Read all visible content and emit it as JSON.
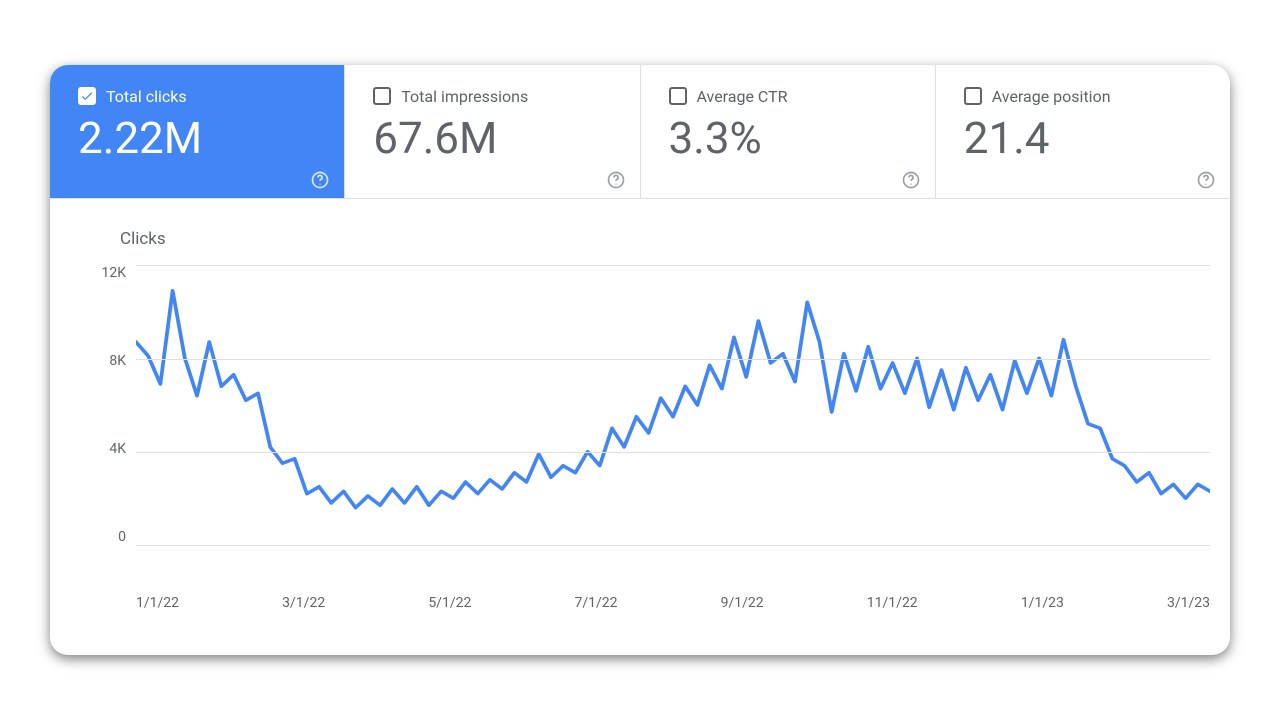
{
  "metrics": [
    {
      "key": "clicks",
      "label": "Total clicks",
      "value": "2.22M",
      "active": true
    },
    {
      "key": "impressions",
      "label": "Total impressions",
      "value": "67.6M",
      "active": false
    },
    {
      "key": "ctr",
      "label": "Average CTR",
      "value": "3.3%",
      "active": false
    },
    {
      "key": "position",
      "label": "Average position",
      "value": "21.4",
      "active": false
    }
  ],
  "chart_data": {
    "type": "line",
    "title": "Clicks",
    "ylabel": "",
    "xlabel": "",
    "ylim": [
      0,
      12000
    ],
    "y_ticks": [
      "12K",
      "8K",
      "4K",
      "0"
    ],
    "x_ticks": [
      "1/1/22",
      "3/1/22",
      "5/1/22",
      "7/1/22",
      "9/1/22",
      "11/1/22",
      "1/1/23",
      "3/1/23"
    ],
    "series": [
      {
        "name": "Clicks",
        "color": "#4285F4",
        "values": [
          8700,
          8100,
          6900,
          10900,
          8000,
          6400,
          8700,
          6800,
          7300,
          6200,
          6500,
          4200,
          3500,
          3700,
          2200,
          2500,
          1800,
          2300,
          1600,
          2100,
          1700,
          2400,
          1800,
          2500,
          1700,
          2300,
          2000,
          2700,
          2200,
          2800,
          2400,
          3100,
          2700,
          3900,
          2900,
          3400,
          3100,
          4000,
          3400,
          5000,
          4200,
          5500,
          4800,
          6300,
          5500,
          6800,
          6000,
          7700,
          6700,
          8900,
          7200,
          9600,
          7800,
          8200,
          7000,
          10400,
          8700,
          5700,
          8200,
          6600,
          8500,
          6700,
          7800,
          6500,
          8000,
          5900,
          7500,
          5800,
          7600,
          6200,
          7300,
          5800,
          7900,
          6500,
          8000,
          6400,
          8800,
          6800,
          5200,
          5000,
          3700,
          3400,
          2700,
          3100,
          2200,
          2600,
          2000,
          2600,
          2300
        ]
      }
    ]
  }
}
